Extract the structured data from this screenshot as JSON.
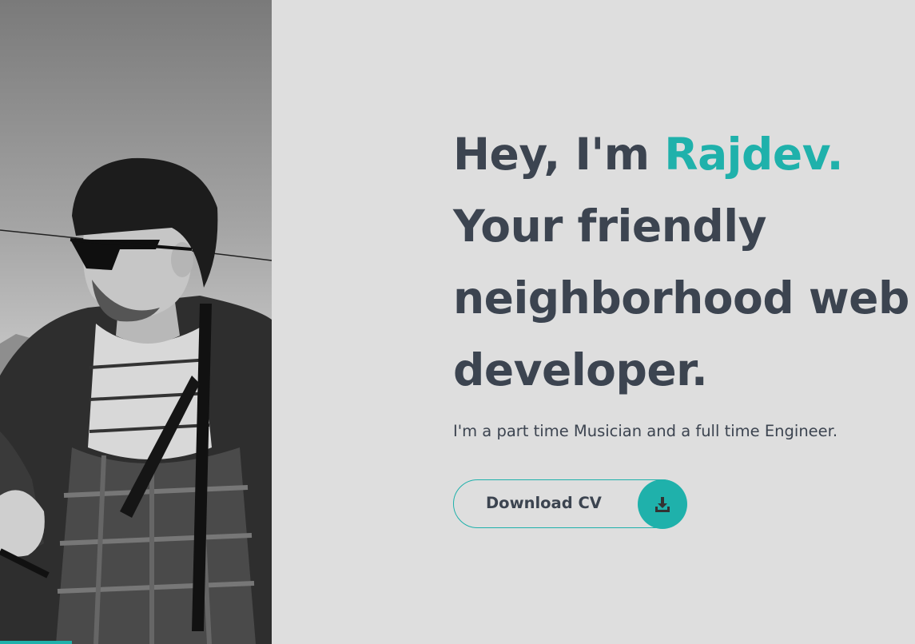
{
  "hero": {
    "greeting": "Hey, I'm ",
    "name": "Rajdev.",
    "line2": "Your friendly",
    "line3": "neighborhood web",
    "line4": "developer.",
    "tagline": "I'm a part time Musician and a full time Engineer."
  },
  "cv_button": {
    "label": "Download CV",
    "icon": "download-icon"
  },
  "photo": {
    "icon": "portrait-photo"
  },
  "colors": {
    "accent": "#1fb1ab",
    "text": "#3c4450",
    "background": "#dedede"
  }
}
